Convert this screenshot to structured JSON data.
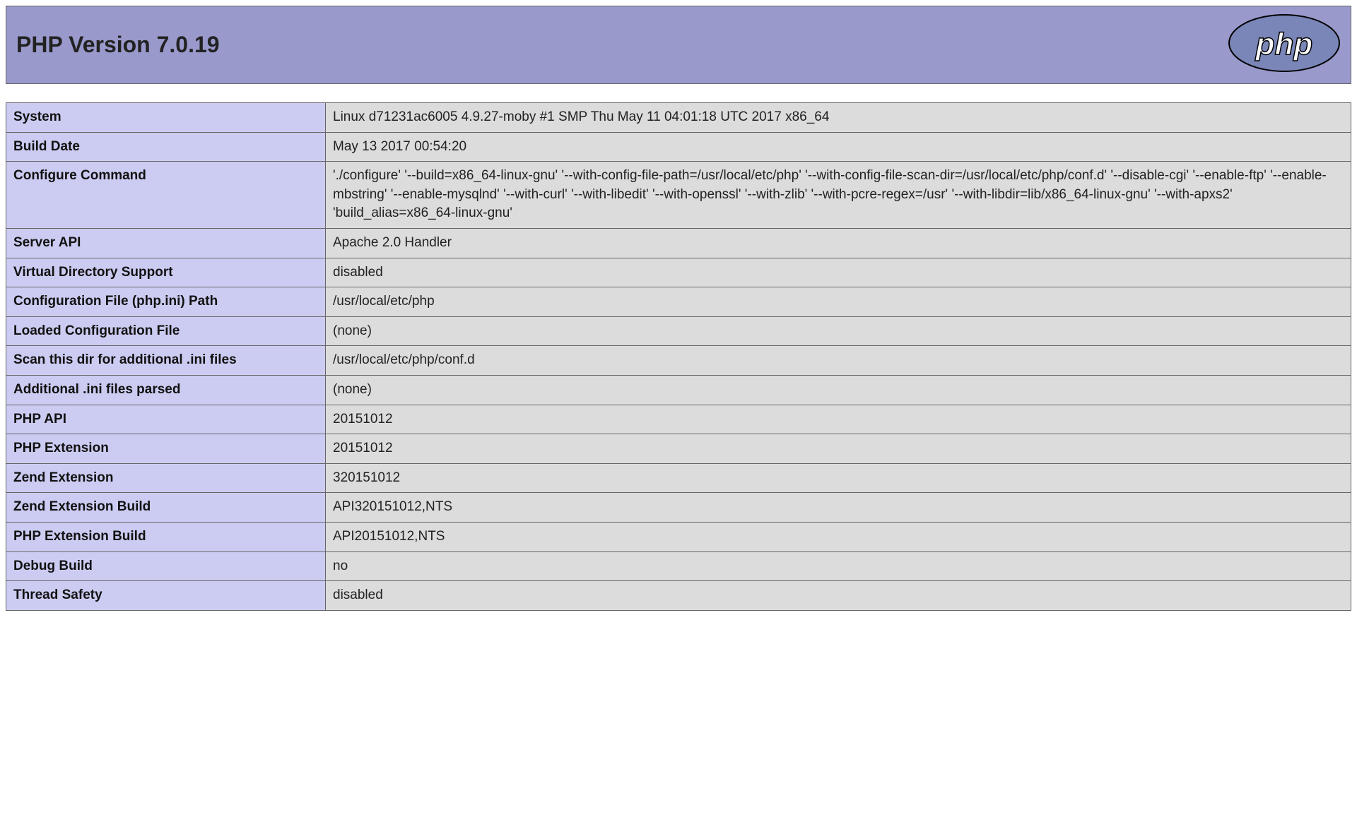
{
  "header": {
    "title": "PHP Version 7.0.19",
    "logo_text": "php"
  },
  "info": {
    "rows": [
      {
        "key": "System",
        "val": "Linux d71231ac6005 4.9.27-moby #1 SMP Thu May 11 04:01:18 UTC 2017 x86_64"
      },
      {
        "key": "Build Date",
        "val": "May 13 2017 00:54:20"
      },
      {
        "key": "Configure Command",
        "val": "'./configure' '--build=x86_64-linux-gnu' '--with-config-file-path=/usr/local/etc/php' '--with-config-file-scan-dir=/usr/local/etc/php/conf.d' '--disable-cgi' '--enable-ftp' '--enable-mbstring' '--enable-mysqlnd' '--with-curl' '--with-libedit' '--with-openssl' '--with-zlib' '--with-pcre-regex=/usr' '--with-libdir=lib/x86_64-linux-gnu' '--with-apxs2' 'build_alias=x86_64-linux-gnu'"
      },
      {
        "key": "Server API",
        "val": "Apache 2.0 Handler"
      },
      {
        "key": "Virtual Directory Support",
        "val": "disabled"
      },
      {
        "key": "Configuration File (php.ini) Path",
        "val": "/usr/local/etc/php"
      },
      {
        "key": "Loaded Configuration File",
        "val": "(none)"
      },
      {
        "key": "Scan this dir for additional .ini files",
        "val": "/usr/local/etc/php/conf.d"
      },
      {
        "key": "Additional .ini files parsed",
        "val": "(none)"
      },
      {
        "key": "PHP API",
        "val": "20151012"
      },
      {
        "key": "PHP Extension",
        "val": "20151012"
      },
      {
        "key": "Zend Extension",
        "val": "320151012"
      },
      {
        "key": "Zend Extension Build",
        "val": "API320151012,NTS"
      },
      {
        "key": "PHP Extension Build",
        "val": "API20151012,NTS"
      },
      {
        "key": "Debug Build",
        "val": "no"
      },
      {
        "key": "Thread Safety",
        "val": "disabled"
      }
    ]
  }
}
